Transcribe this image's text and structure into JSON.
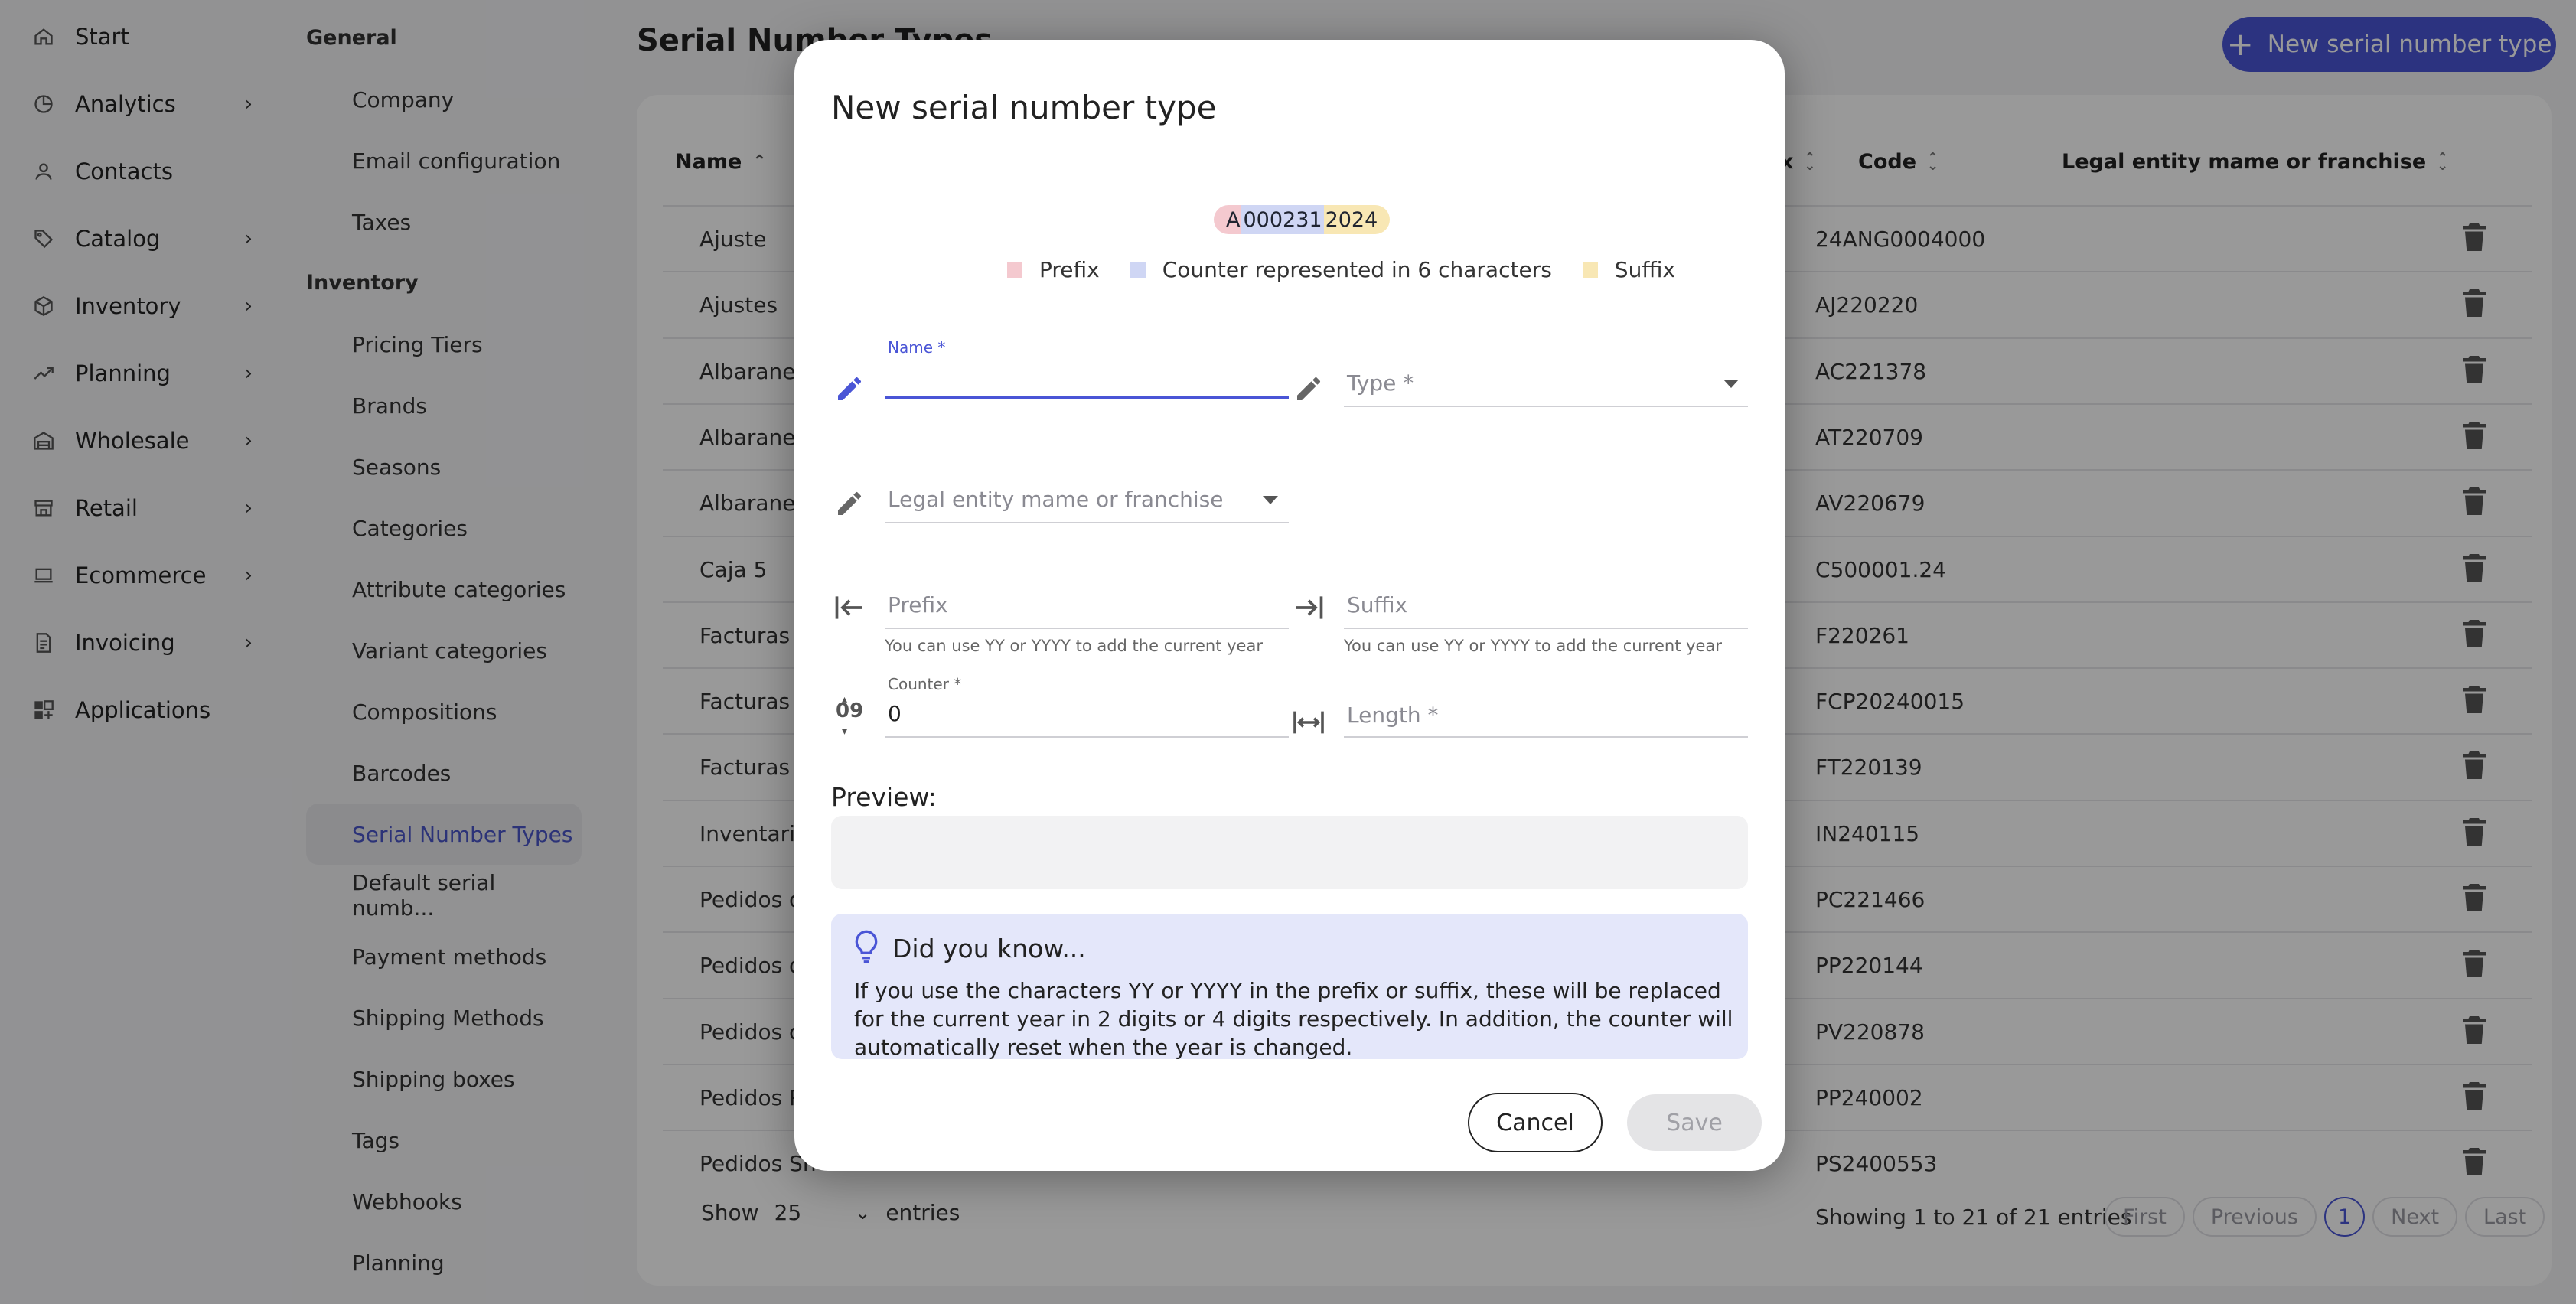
{
  "nav": {
    "items": [
      {
        "label": "Start",
        "icon": "home-icon",
        "chevron": false
      },
      {
        "label": "Analytics",
        "icon": "analytics-icon",
        "chevron": true
      },
      {
        "label": "Contacts",
        "icon": "user-icon",
        "chevron": false
      },
      {
        "label": "Catalog",
        "icon": "tag-icon",
        "chevron": true
      },
      {
        "label": "Inventory",
        "icon": "box-icon",
        "chevron": true
      },
      {
        "label": "Planning",
        "icon": "trend-icon",
        "chevron": true
      },
      {
        "label": "Wholesale",
        "icon": "warehouse-icon",
        "chevron": true
      },
      {
        "label": "Retail",
        "icon": "store-icon",
        "chevron": true
      },
      {
        "label": "Ecommerce",
        "icon": "laptop-icon",
        "chevron": true
      },
      {
        "label": "Invoicing",
        "icon": "document-icon",
        "chevron": true
      },
      {
        "label": "Applications",
        "icon": "apps-icon",
        "chevron": false
      }
    ],
    "chevron_glyph": "›"
  },
  "settings": {
    "general_title": "General",
    "general_items": [
      "Company",
      "Email configuration",
      "Taxes"
    ],
    "inventory_title": "Inventory",
    "inventory_items": [
      "Pricing Tiers",
      "Brands",
      "Seasons",
      "Categories",
      "Attribute categories",
      "Variant categories",
      "Compositions",
      "Barcodes",
      "Serial Number Types",
      "Default serial numb...",
      "Payment methods",
      "Shipping Methods",
      "Shipping boxes",
      "Tags",
      "Webhooks",
      "Planning"
    ],
    "active_item": "Serial Number Types"
  },
  "page": {
    "title": "Serial Number Types",
    "new_button": "New serial number type"
  },
  "table": {
    "headers": {
      "name": "Name",
      "suffix_partial": "x",
      "code": "Code",
      "legal": "Legal entity mame or franchise"
    },
    "rows": [
      {
        "name": "Ajuste",
        "code": "24ANG0004000"
      },
      {
        "name": "Ajustes",
        "code": "AJ220220"
      },
      {
        "name": "Albaranes",
        "code": "AC221378"
      },
      {
        "name": "Albaranes",
        "code": "AT220709"
      },
      {
        "name": "Albaranes",
        "code": "AV220679"
      },
      {
        "name": "Caja 5",
        "code": "C500001.24"
      },
      {
        "name": "Facturas",
        "code": "F220261"
      },
      {
        "name": "Facturas c",
        "code": "FCP20240015"
      },
      {
        "name": "Facturas t",
        "code": "FT220139"
      },
      {
        "name": "Inventario",
        "code": "IN240115"
      },
      {
        "name": "Pedidos d",
        "code": "PC221466"
      },
      {
        "name": "Pedidos d",
        "code": "PP220144"
      },
      {
        "name": "Pedidos d",
        "code": "PV220878"
      },
      {
        "name": "Pedidos P",
        "code": "PP240002"
      },
      {
        "name": "Pedidos Sh",
        "code": "PS2400553"
      }
    ],
    "show_label": "Show",
    "show_value": "25",
    "entries_label": "entries",
    "info": "Showing 1 to 21 of 21 entries",
    "pager": {
      "first": "First",
      "previous": "Previous",
      "current": "1",
      "next": "Next",
      "last": "Last"
    }
  },
  "modal": {
    "title": "New serial number type",
    "example": {
      "prefix": "A",
      "counter": "000231",
      "suffix": "2024"
    },
    "legend": {
      "prefix": "Prefix",
      "counter": "Counter represented in 6 characters",
      "suffix": "Suffix"
    },
    "colors": {
      "prefix": "#f4c9cf",
      "counter": "#cfd6f4",
      "suffix": "#f8e7b4",
      "accent": "#4a55d6"
    },
    "fields": {
      "name_label": "Name *",
      "name_value": "",
      "type_placeholder": "Type *",
      "legal_placeholder": "Legal entity mame or franchise",
      "prefix_placeholder": "Prefix",
      "prefix_help": "You can use YY or YYYY to add the current year",
      "suffix_placeholder": "Suffix",
      "suffix_help": "You can use YY or YYYY to add the current year",
      "counter_label": "Counter *",
      "counter_value": "0",
      "length_placeholder": "Length *",
      "counter_icon_text": "09"
    },
    "preview_label": "Preview:",
    "preview_value": "",
    "tip_title": "Did you know...",
    "tip_text": "If you use the characters YY or YYYY in the prefix or suffix, these will be replaced for the current year in 2 digits or 4 digits respectively. In addition, the counter will automatically reset when the year is changed.",
    "cancel": "Cancel",
    "save": "Save"
  }
}
